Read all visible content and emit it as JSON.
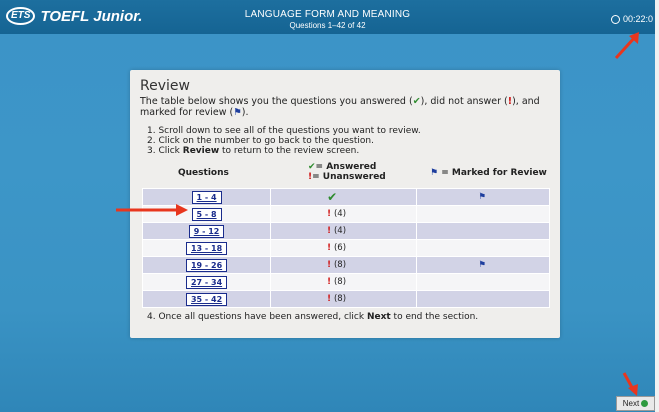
{
  "header": {
    "logo_badge": "ETS",
    "logo_text": "TOEFL Junior.",
    "title": "LANGUAGE FORM AND MEANING",
    "subtitle": "Questions 1–42 of 42",
    "timer": "00:22:0"
  },
  "panel": {
    "title": "Review",
    "intro_1": "The table below shows you the questions you answered (",
    "intro_2": "), did not answer (",
    "intro_3": "), and marked for review (",
    "intro_4": ").",
    "step_1": "1. Scroll down to see all of the questions you want to review.",
    "step_2": "2. Click on the number to go back to the question.",
    "step_3_pre": "3. Click ",
    "step_3_bold": "Review",
    "step_3_post": " to return to the review screen.",
    "col_questions": "Questions",
    "col_answered": "= Answered",
    "col_unanswered": "= Unanswered",
    "col_marked": "= Marked for Review",
    "final_pre": "4. Once all questions have been answered, click ",
    "final_bold": "Next",
    "final_post": " to end the section."
  },
  "rows": [
    {
      "range": "1 - 4",
      "status": "answered",
      "count": "",
      "marked": true
    },
    {
      "range": "5 - 8",
      "status": "unanswered",
      "count": "(4)",
      "marked": false
    },
    {
      "range": "9 - 12",
      "status": "unanswered",
      "count": "(4)",
      "marked": false
    },
    {
      "range": "13 - 18",
      "status": "unanswered",
      "count": "(6)",
      "marked": false
    },
    {
      "range": "19 - 26",
      "status": "unanswered",
      "count": "(8)",
      "marked": true
    },
    {
      "range": "27 - 34",
      "status": "unanswered",
      "count": "(8)",
      "marked": false
    },
    {
      "range": "35 - 42",
      "status": "unanswered",
      "count": "(8)",
      "marked": false
    }
  ],
  "footer": {
    "next_label": "Next"
  },
  "colors": {
    "accent_blue": "#1d6f9f",
    "answered": "#2e8b2e",
    "unanswered": "#d01515",
    "annotation_arrow": "#e8361e"
  }
}
